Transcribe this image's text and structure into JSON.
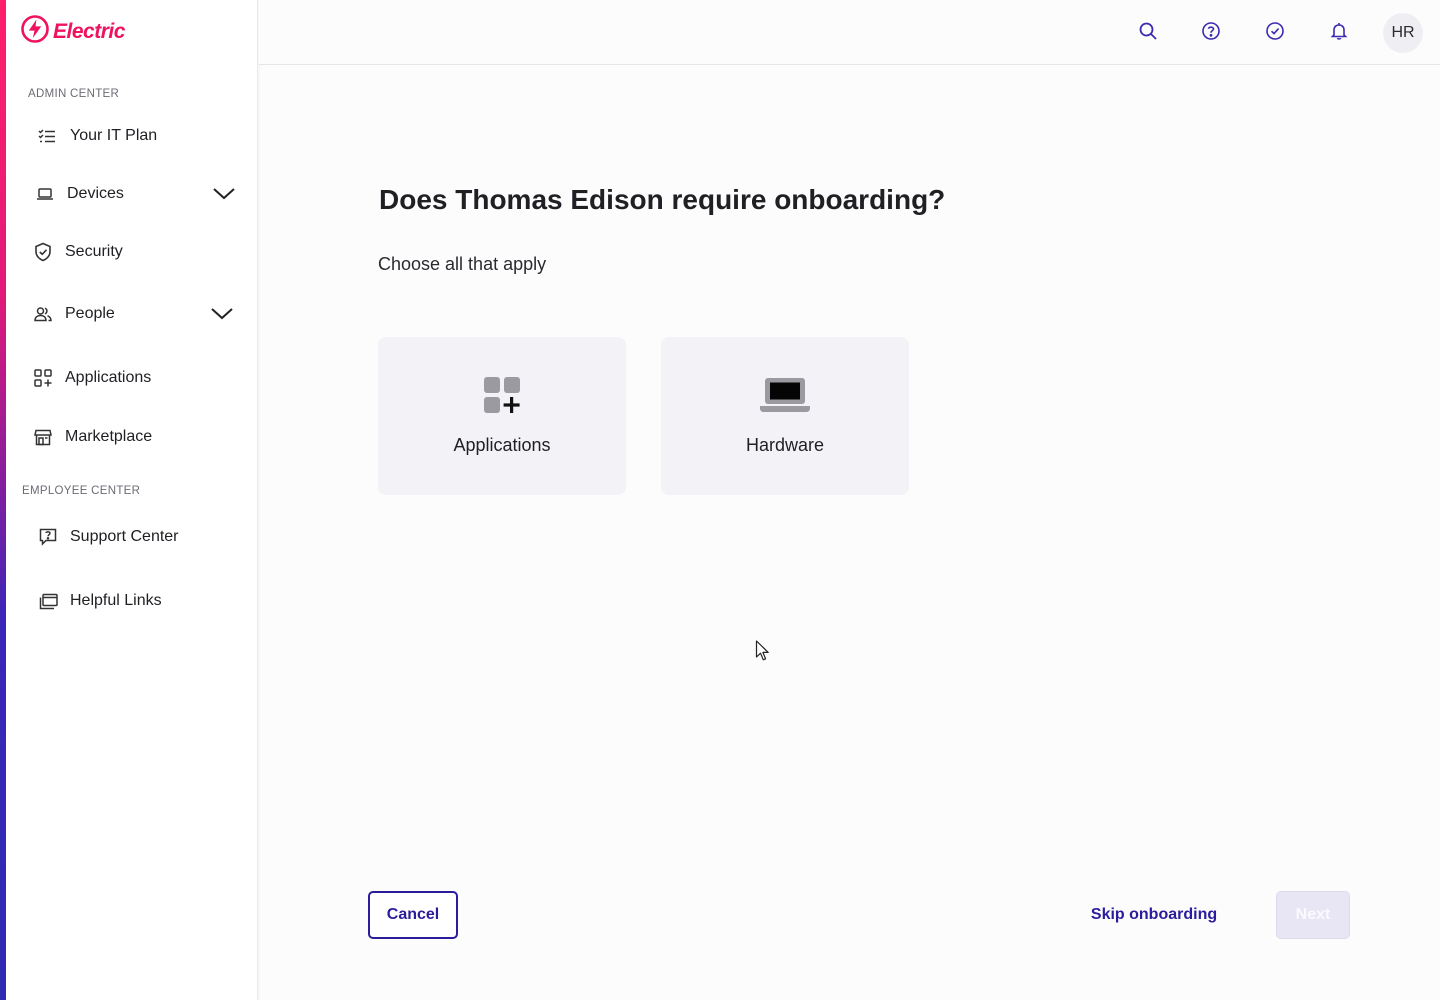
{
  "brand": {
    "name": "Electric",
    "color": "#f0125f"
  },
  "sidebar": {
    "admin_section": "ADMIN CENTER",
    "employee_section": "EMPLOYEE CENTER",
    "items": [
      {
        "label": "Your IT Plan",
        "icon": "checklist-icon"
      },
      {
        "label": "Devices",
        "icon": "laptop-icon",
        "expandable": true
      },
      {
        "label": "Security",
        "icon": "shield-icon"
      },
      {
        "label": "People",
        "icon": "people-icon",
        "expandable": true
      },
      {
        "label": "Applications",
        "icon": "apps-grid-icon"
      },
      {
        "label": "Marketplace",
        "icon": "storefront-icon"
      },
      {
        "label": "Support Center",
        "icon": "support-chat-icon"
      },
      {
        "label": "Helpful Links",
        "icon": "links-window-icon"
      }
    ]
  },
  "topbar": {
    "icons": [
      "search-icon",
      "help-icon",
      "check-circle-icon",
      "bell-icon"
    ],
    "avatar_initials": "HR"
  },
  "main": {
    "title": "Does Thomas Edison require onboarding?",
    "subtitle": "Choose all that apply",
    "options": [
      {
        "label": "Applications",
        "icon": "apps-add-icon"
      },
      {
        "label": "Hardware",
        "icon": "laptop-icon"
      }
    ]
  },
  "footer": {
    "cancel_label": "Cancel",
    "skip_label": "Skip onboarding",
    "next_label": "Next"
  },
  "colors": {
    "primary": "#2b1c9c",
    "icon_accent": "#3a2bb0",
    "card_bg": "#f3f3f7"
  }
}
